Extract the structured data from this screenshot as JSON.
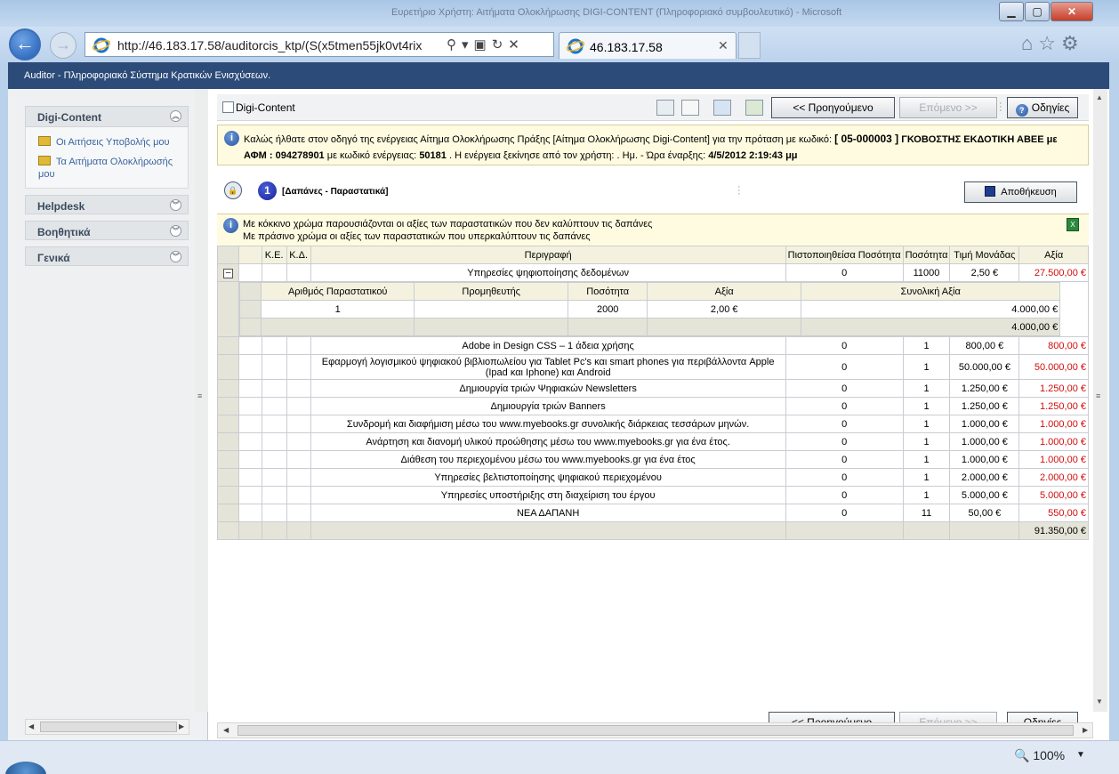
{
  "browser": {
    "window_title": "Ευρετήριο Χρήστη: Αιτήματα Ολοκλήρωσης DIGI-CONTENT (Πληροφοριακό συμβουλευτικό) - Microsoft",
    "address": "http://46.183.17.58/auditorcis_ktp/(S(x5tmen55jk0vt4rix",
    "tab_title": "46.183.17.58",
    "zoom": "100%"
  },
  "app": {
    "header": "Auditor - Πληροφοριακό Σύστημα Κρατικών Ενισχύσεων."
  },
  "sidebar": {
    "sections": [
      {
        "title": "Digi-Content",
        "items": [
          "Οι Αιτήσεις Υποβολής μου",
          "Τα Αιτήματα Ολοκλήρωσής μου"
        ]
      },
      {
        "title": "Helpdesk"
      },
      {
        "title": "Βοηθητικά"
      },
      {
        "title": "Γενικά"
      }
    ]
  },
  "toolbar": {
    "page_name": "Digi-Content",
    "prev_label": "<< Προηγούμενο",
    "next_label": "Επόμενο >>",
    "help_label": "Οδηγίες"
  },
  "info": {
    "line1_prefix": "Καλώς ήλθατε στον οδηγό της ενέργειας Αίτημα Ολοκλήρωσης Πράξης [Αίτημα Ολοκλήρωσης Digi-Content] για την πρόταση με κωδικό:",
    "proposal_code": "[ 05-000003 ]",
    "company": "ΓΚΟΒΟΣΤΗΣ ΕΚΔΟΤΙΚΗ ΑΒΕΕ με",
    "afm_label": "ΑΦΜ : 094278901",
    "action_code_label": "με κωδικό ενέργειας:",
    "action_code": "50181",
    "started_by": ". Η ενέργεια ξεκίνησε από τον χρήστη: . Ημ. - Ώρα έναρξης:",
    "start_time": "4/5/2012 2:19:43 μμ"
  },
  "step": {
    "number": "1",
    "title": "[Δαπάνες - Παραστατικά]",
    "save_label": "Αποθήκευση"
  },
  "legend": {
    "red_text": "Με κόκκινο χρώμα παρουσιάζονται οι αξίες των παραστατικών που δεν καλύπτουν τις δαπάνες",
    "green_text": "Με πράσινο χρώμα οι αξίες των παραστατικών που υπερκαλύπτουν τις δαπάνες"
  },
  "grid": {
    "headers": [
      "Κ.Ε.",
      "Κ.Δ.",
      "Περιγραφή",
      "Πιστοποιηθείσα Ποσότητα",
      "Ποσότητα",
      "Τιμή Μονάδας",
      "Αξία"
    ],
    "expanded_row": {
      "description": "Υπηρεσίες ψηφιοποίησης δεδομένων",
      "certified": "0",
      "quantity": "11000",
      "unit_price": "2,50 €",
      "value": "27.500,00 €"
    },
    "sub_headers": [
      "Αριθμός Παραστατικού",
      "Προμηθευτής",
      "Ποσότητα",
      "Αξία",
      "Συνολική Αξία"
    ],
    "sub_row": {
      "number": "1",
      "supplier": "",
      "quantity": "2000",
      "value": "2,00 €",
      "total": "4.000,00 €"
    },
    "sub_total": "4.000,00 €",
    "rows": [
      {
        "description": "Adobe in Design CSS – 1 άδεια χρήσης",
        "certified": "0",
        "quantity": "1",
        "unit_price": "800,00 €",
        "value": "800,00 €"
      },
      {
        "description": "Εφαρμογή λογισμικού ψηφιακού βιβλιοπωλείου για Tablet Pc's και smart phones για περιβάλλοντα Apple (Ipad και Iphone) και Android",
        "certified": "0",
        "quantity": "1",
        "unit_price": "50.000,00 €",
        "value": "50.000,00 €"
      },
      {
        "description": "Δημιουργία τριών Ψηφιακών Newsletters",
        "certified": "0",
        "quantity": "1",
        "unit_price": "1.250,00 €",
        "value": "1.250,00 €"
      },
      {
        "description": "Δημιουργία τριών Banners",
        "certified": "0",
        "quantity": "1",
        "unit_price": "1.250,00 €",
        "value": "1.250,00 €"
      },
      {
        "description": "Συνδρομή και διαφήμιση μέσω του www.myebooks.gr συνολικής διάρκειας τεσσάρων μηνών.",
        "certified": "0",
        "quantity": "1",
        "unit_price": "1.000,00 €",
        "value": "1.000,00 €"
      },
      {
        "description": "Ανάρτηση και διανομή υλικού προώθησης μέσω του www.myebooks.gr για ένα έτος.",
        "certified": "0",
        "quantity": "1",
        "unit_price": "1.000,00 €",
        "value": "1.000,00 €"
      },
      {
        "description": "Διάθεση του περιεχομένου μέσω του www.myebooks.gr για ένα έτος",
        "certified": "0",
        "quantity": "1",
        "unit_price": "1.000,00 €",
        "value": "1.000,00 €"
      },
      {
        "description": "Υπηρεσίες βελτιστοποίησης ψηφιακού περιεχομένου",
        "certified": "0",
        "quantity": "1",
        "unit_price": "2.000,00 €",
        "value": "2.000,00 €"
      },
      {
        "description": "Υπηρεσίες υποστήριξης στη διαχείριση του έργου",
        "certified": "0",
        "quantity": "1",
        "unit_price": "5.000,00 €",
        "value": "5.000,00 €"
      },
      {
        "description": "ΝΕΑ ΔΑΠΑΝΗ",
        "certified": "0",
        "quantity": "11",
        "unit_price": "50,00 €",
        "value": "550,00 €"
      }
    ],
    "grand_total": "91.350,00 €"
  },
  "colors": {
    "header_bg": "#2c4b79",
    "info_bg": "#fffbe0",
    "deficit_red": "#d20d0d"
  }
}
